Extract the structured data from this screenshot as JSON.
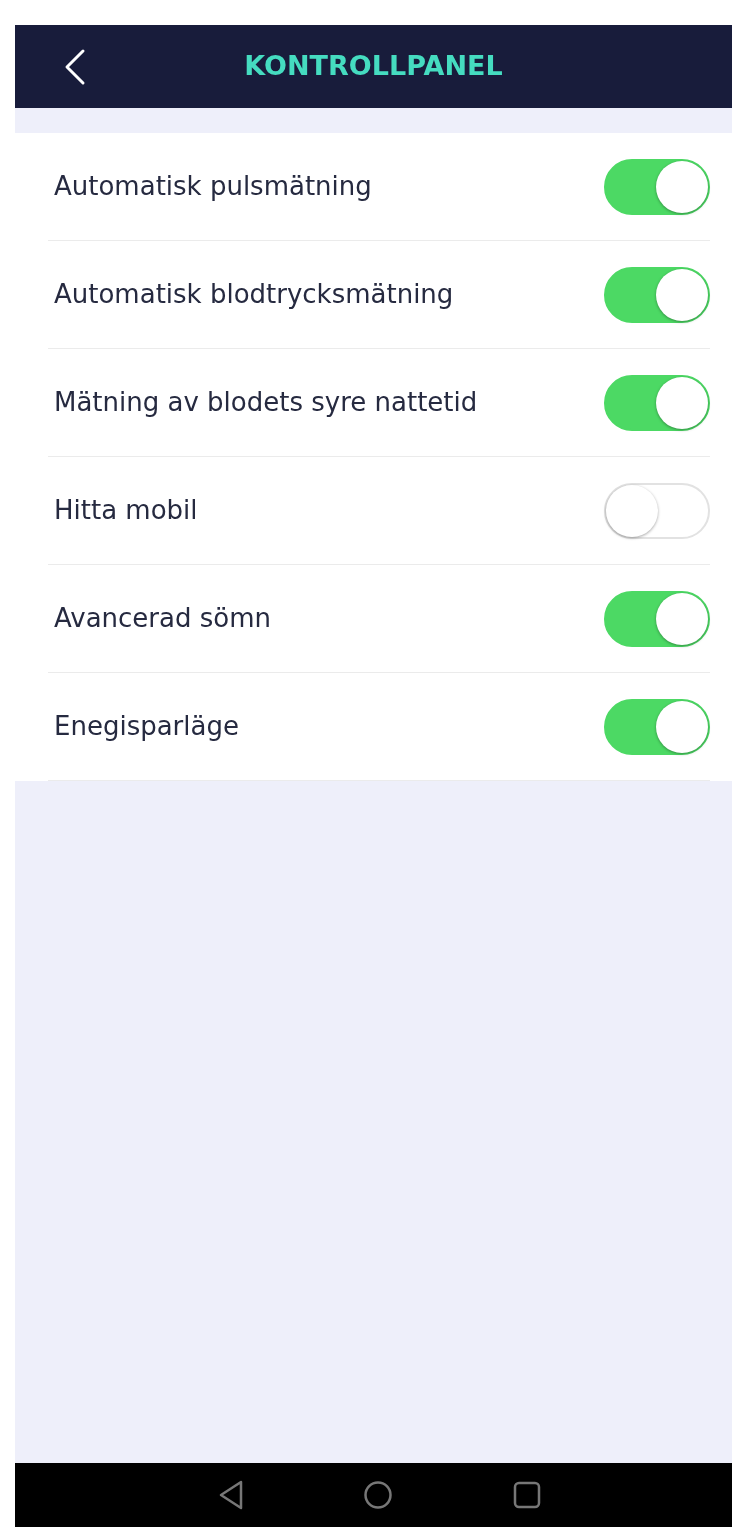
{
  "header": {
    "title": "KONTROLLPANEL"
  },
  "settings": [
    {
      "label": "Automatisk pulsmätning",
      "on": true
    },
    {
      "label": "Automatisk blodtrycksmätning",
      "on": true
    },
    {
      "label": "Mätning av blodets syre nattetid",
      "on": true
    },
    {
      "label": "Hitta mobil",
      "on": false
    },
    {
      "label": "Avancerad sömn",
      "on": true
    },
    {
      "label": "Enegisparläge",
      "on": true
    }
  ]
}
